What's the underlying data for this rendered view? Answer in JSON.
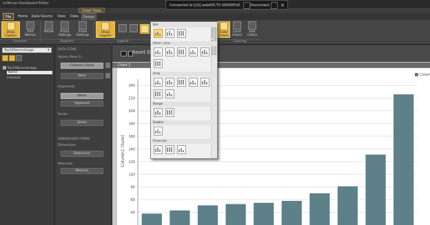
{
  "window": {
    "title": "ovTerran Dashboard Editor"
  },
  "connection": {
    "text": "Connected to [LO] webIOS.TV U6000FUD",
    "status": "Disconnect"
  },
  "ribbon_context": {
    "title": "Chart Tools"
  },
  "tabs": {
    "file": "File",
    "items": [
      "Home",
      "Data Source",
      "View",
      "Data",
      "Design"
    ]
  },
  "ribbon": {
    "buttons": {
      "show_caption": "Show Caption",
      "edit_names": "Edit Names",
      "rotate": "Rotate",
      "x_axis": "X-Axis Settings",
      "y_axis": "Y-Axis Settings",
      "show_legend": "Show Legend",
      "color_by": "Color Colors",
      "local_colors": "Local Colors",
      "edit_colors": "Edit Colors"
    },
    "groups": {
      "common": "Common",
      "diagram": "Diagram",
      "legend": "Legend",
      "coloring": "Coloring"
    }
  },
  "left_panel": {
    "datasource_value": "Top10DeviceUsage",
    "tree": {
      "root": "Top10DeviceUsage",
      "fields": [
        "Name",
        "Column1"
      ]
    }
  },
  "data_items": {
    "header": "DATA ITEMS",
    "values_label": "Values (Pane 1)",
    "values_pill": "Column1 (Sum)",
    "values_well": "Value",
    "arguments_label": "Arguments",
    "arguments_pill": "Name",
    "arguments_well": "Argument",
    "series_label": "Series",
    "series_well": "Series",
    "hidden_header": "HIDDEN DATA ITEMS",
    "dimensions_label": "Dimensions",
    "dimensions_well": "Dimension",
    "measures_label": "Measures",
    "measures_well": "Measure"
  },
  "dashboard": {
    "title": "Asset Dash",
    "chart_tab": "Chart 1"
  },
  "gallery": {
    "sections": [
      "Bar",
      "Point / Line",
      "Area",
      "Range",
      "Bubble",
      "Financial"
    ]
  },
  "colors": {
    "accent": "#e1b444",
    "bar": "#5d8089"
  },
  "chart_data": {
    "type": "bar",
    "ylabel": "Column1 (Sum)",
    "ylim": [
      20,
      250
    ],
    "yticks": [
      40,
      60,
      80,
      100,
      120,
      140,
      160,
      180,
      200,
      220,
      240
    ],
    "legend": "Column1",
    "series": [
      {
        "name": "Column1",
        "values": [
          38,
          43,
          51,
          53,
          55,
          58,
          70,
          81,
          131,
          226
        ]
      }
    ]
  }
}
